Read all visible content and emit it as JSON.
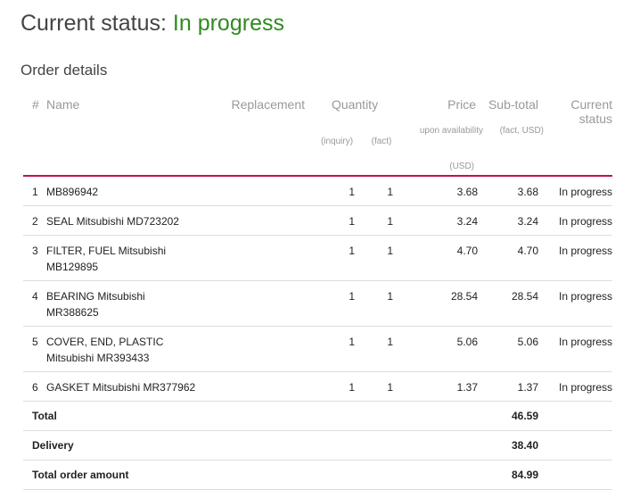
{
  "status": {
    "label": "Current status:",
    "value": "In progress",
    "value_color": "#2f8a1f"
  },
  "section_title": "Order details",
  "headers": {
    "num": "#",
    "name": "Name",
    "replacement": "Replacement",
    "quantity": "Quantity",
    "quantity_inquiry": "(inquiry)",
    "quantity_fact": "(fact)",
    "price": "Price",
    "price_sub1": "upon availability",
    "price_sub2": "(USD)",
    "subtotal": "Sub-total",
    "subtotal_sub": "(fact, USD)",
    "status": "Current status"
  },
  "rows": [
    {
      "num": "1",
      "name_line1": "MB896942",
      "name_line2": "",
      "replacement": "",
      "qty_inquiry": "1",
      "qty_fact": "1",
      "price": "3.68",
      "subtotal": "3.68",
      "status": "In progress"
    },
    {
      "num": "2",
      "name_line1": "SEAL Mitsubishi MD723202",
      "name_line2": "",
      "replacement": "",
      "qty_inquiry": "1",
      "qty_fact": "1",
      "price": "3.24",
      "subtotal": "3.24",
      "status": "In progress"
    },
    {
      "num": "3",
      "name_line1": "FILTER, FUEL Mitsubishi",
      "name_line2": "MB129895",
      "replacement": "",
      "qty_inquiry": "1",
      "qty_fact": "1",
      "price": "4.70",
      "subtotal": "4.70",
      "status": "In progress"
    },
    {
      "num": "4",
      "name_line1": "BEARING Mitsubishi",
      "name_line2": "MR388625",
      "replacement": "",
      "qty_inquiry": "1",
      "qty_fact": "1",
      "price": "28.54",
      "subtotal": "28.54",
      "status": "In progress"
    },
    {
      "num": "5",
      "name_line1": "COVER, END, PLASTIC",
      "name_line2": "Mitsubishi MR393433",
      "replacement": "",
      "qty_inquiry": "1",
      "qty_fact": "1",
      "price": "5.06",
      "subtotal": "5.06",
      "status": "In progress"
    },
    {
      "num": "6",
      "name_line1": "GASKET Mitsubishi MR377962",
      "name_line2": "",
      "replacement": "",
      "qty_inquiry": "1",
      "qty_fact": "1",
      "price": "1.37",
      "subtotal": "1.37",
      "status": "In progress"
    }
  ],
  "summary": [
    {
      "label": "Total",
      "value": "46.59"
    },
    {
      "label": "Delivery",
      "value": "38.40"
    },
    {
      "label": "Total order amount",
      "value": "84.99"
    }
  ],
  "colors": {
    "accent_line": "#c0144a",
    "status_green": "#2f8a1f"
  }
}
